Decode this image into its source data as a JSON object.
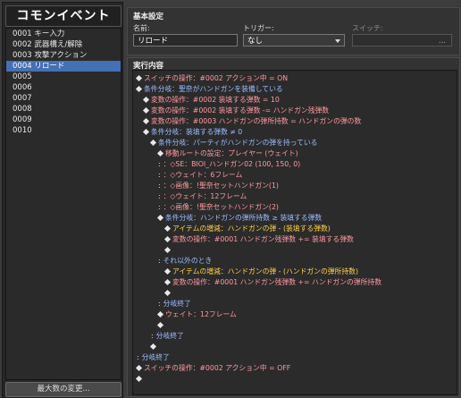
{
  "left_panel": {
    "title": "コモンイベント",
    "events": [
      {
        "label": "0001 キー入力"
      },
      {
        "label": "0002 武器構え/解除"
      },
      {
        "label": "0003 攻撃アクション"
      },
      {
        "label": "0004 リロード",
        "selected": true
      },
      {
        "label": "0005"
      },
      {
        "label": "0006"
      },
      {
        "label": "0007"
      },
      {
        "label": "0008"
      },
      {
        "label": "0009"
      },
      {
        "label": "0010"
      }
    ],
    "max_button": "最大数の変更..."
  },
  "general": {
    "title": "基本設定",
    "name_label": "名前:",
    "name_value": "リロード",
    "trigger_label": "トリガー:",
    "trigger_value": "なし",
    "switch_label": "スイッチ:",
    "switch_button": "..."
  },
  "contents": {
    "title": "実行内容",
    "lines": [
      {
        "indent": 0,
        "marker": "◆",
        "text": "スイッチの操作：#0002 アクション中 = ON",
        "color": "red"
      },
      {
        "indent": 0,
        "marker": "◆",
        "text": "条件分岐：聖奈がハンドガンを装備している",
        "color": "blue"
      },
      {
        "indent": 1,
        "marker": "◆",
        "text": "変数の操作：#0002 装填する弾数 = 10",
        "color": "red"
      },
      {
        "indent": 1,
        "marker": "◆",
        "text": "変数の操作：#0002 装填する弾数 -= ハンドガン残弾数",
        "color": "red"
      },
      {
        "indent": 1,
        "marker": "◆",
        "text": "変数の操作：#0003 ハンドガンの弾所持数 = ハンドガンの弾の数",
        "color": "red"
      },
      {
        "indent": 1,
        "marker": "◆",
        "text": "条件分岐：装填する弾数 ≠ 0",
        "color": "blue"
      },
      {
        "indent": 2,
        "marker": "◆",
        "text": "条件分岐：パーティがハンドガンの弾を持っている",
        "color": "blue"
      },
      {
        "indent": 3,
        "marker": "◆",
        "text": "移動ルートの設定：プレイヤー (ウェイト)",
        "color": "red"
      },
      {
        "indent": 3,
        "marker": ":",
        "text": "：◇SE：BIOI_ハンドガン02 (100, 150, 0)",
        "color": "red"
      },
      {
        "indent": 3,
        "marker": ":",
        "text": "：◇ウェイト：6フレーム",
        "color": "red"
      },
      {
        "indent": 3,
        "marker": ":",
        "text": "：◇画像：!聖奈セットハンドガン(1)",
        "color": "red"
      },
      {
        "indent": 3,
        "marker": ":",
        "text": "：◇ウェイト：12フレーム",
        "color": "red"
      },
      {
        "indent": 3,
        "marker": ":",
        "text": "：◇画像：!聖奈セットハンドガン(2)",
        "color": "red"
      },
      {
        "indent": 3,
        "marker": "◆",
        "text": "条件分岐：ハンドガンの弾所持数 ≥ 装填する弾数",
        "color": "blue"
      },
      {
        "indent": 4,
        "marker": "◆",
        "text": "アイテムの増減：ハンドガンの弾 - (装填する弾数)",
        "color": "yellow"
      },
      {
        "indent": 4,
        "marker": "◆",
        "text": "変数の操作：#0001 ハンドガン残弾数 += 装填する弾数",
        "color": "red"
      },
      {
        "indent": 4,
        "marker": "◆",
        "text": "",
        "color": "white"
      },
      {
        "indent": 3,
        "marker": ":",
        "text": "それ以外のとき",
        "color": "blue"
      },
      {
        "indent": 4,
        "marker": "◆",
        "text": "アイテムの増減：ハンドガンの弾 - (ハンドガンの弾所持数)",
        "color": "yellow"
      },
      {
        "indent": 4,
        "marker": "◆",
        "text": "変数の操作：#0001 ハンドガン残弾数 += ハンドガンの弾所持数",
        "color": "red"
      },
      {
        "indent": 4,
        "marker": "◆",
        "text": "",
        "color": "white"
      },
      {
        "indent": 3,
        "marker": ":",
        "text": "分岐終了",
        "color": "blue"
      },
      {
        "indent": 3,
        "marker": "◆",
        "text": "ウェイト：12フレーム",
        "color": "red"
      },
      {
        "indent": 3,
        "marker": "◆",
        "text": "",
        "color": "white"
      },
      {
        "indent": 2,
        "marker": ":",
        "text": "分岐終了",
        "color": "blue"
      },
      {
        "indent": 2,
        "marker": "◆",
        "text": "",
        "color": "white"
      },
      {
        "indent": 0,
        "marker": ":",
        "text": "分岐終了",
        "color": "blue"
      },
      {
        "indent": 0,
        "marker": "◆",
        "text": "スイッチの操作：#0002 アクション中 = OFF",
        "color": "red"
      },
      {
        "indent": 0,
        "marker": "◆",
        "text": "",
        "color": "white"
      }
    ]
  },
  "colors": {
    "selection": "#4470b4",
    "command_red": "#ff9aa0",
    "command_blue": "#9bbcff",
    "command_yellow": "#ffd24a"
  }
}
